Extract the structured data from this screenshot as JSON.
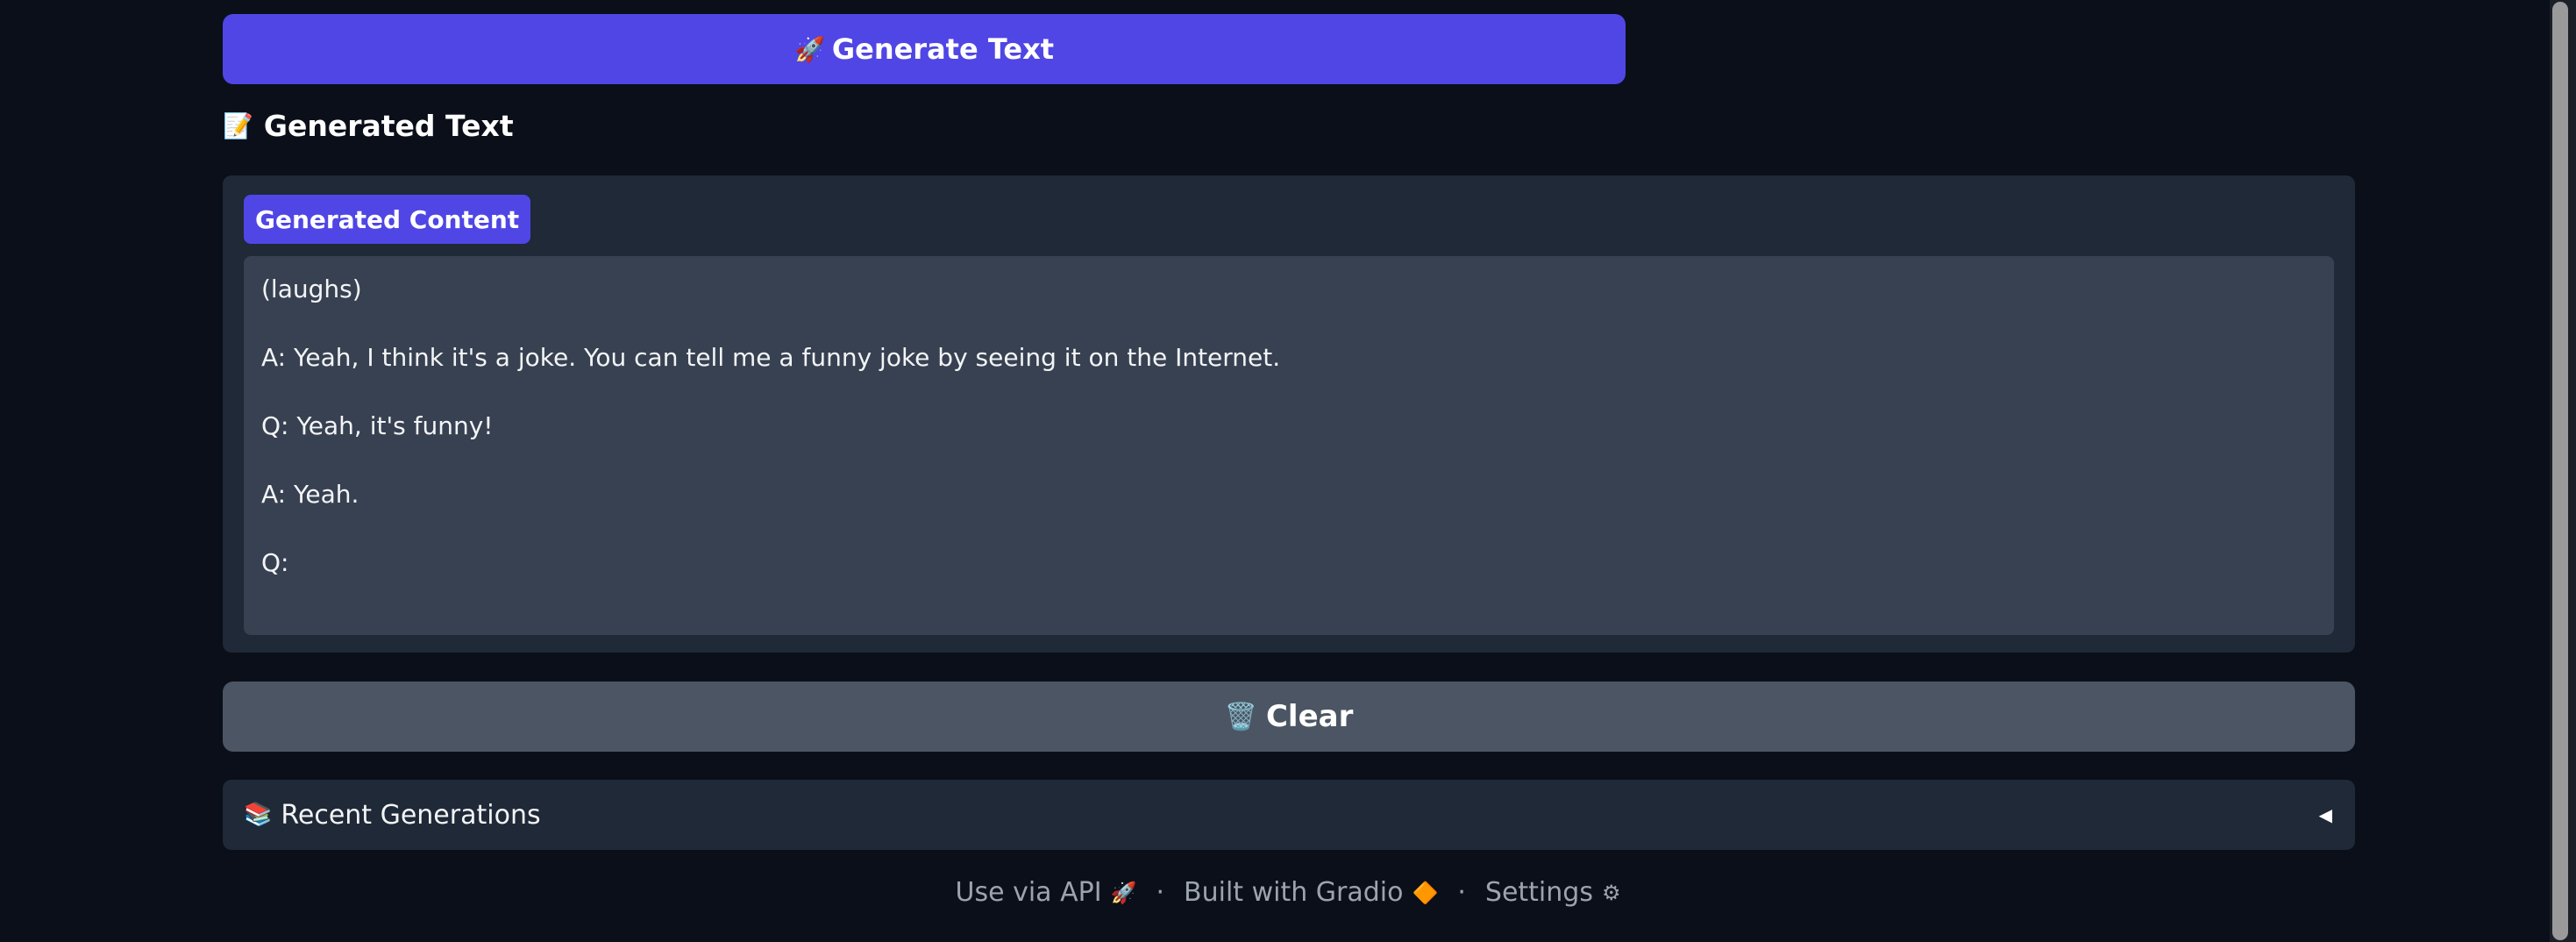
{
  "generate_button": {
    "icon": "rocket-icon",
    "icon_glyph": "🚀",
    "label": "Generate Text",
    "color": "#4f46e5"
  },
  "output_section": {
    "icon": "memo-icon",
    "icon_glyph": "📝",
    "heading": "Generated Text",
    "textbox_label": "Generated Content",
    "lines": [
      "(laughs)",
      "",
      "A: Yeah, I think it's a joke. You can tell me a funny joke by seeing it on the Internet.",
      "",
      "Q: Yeah, it's funny!",
      "",
      "A: Yeah.",
      "",
      "Q:"
    ]
  },
  "clear_button": {
    "icon": "wastebasket-icon",
    "icon_glyph": "🗑️",
    "label": "Clear",
    "color": "#4b5563"
  },
  "recent_generations": {
    "icon": "books-icon",
    "icon_glyph": "📚",
    "label": "Recent Generations",
    "caret": "◀"
  },
  "footer": {
    "api_label": "Use via API",
    "api_icon": "🚀",
    "separator": "·",
    "gradio_label": "Built with Gradio",
    "gradio_icon": "🔶",
    "settings_label": "Settings",
    "settings_icon": "⚙"
  },
  "theme": {
    "background": "#0b0f19",
    "panel": "#1f2937",
    "textbox": "#374151",
    "accent": "#4f46e5"
  }
}
